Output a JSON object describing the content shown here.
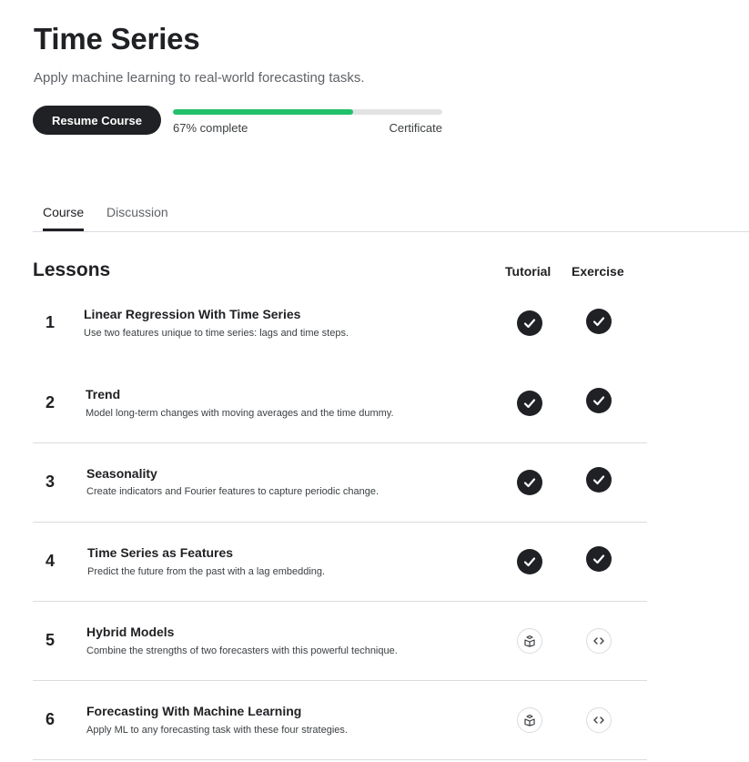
{
  "course": {
    "title": "Time Series",
    "subtitle": "Apply machine learning to real-world forecasting tasks.",
    "resume_label": "Resume Course",
    "progress_fraction": 0.67,
    "progress_text": "67% complete",
    "certificate_label": "Certificate",
    "accent_color": "#20c16a"
  },
  "tabs": [
    {
      "label": "Course",
      "active": true
    },
    {
      "label": "Discussion",
      "active": false
    }
  ],
  "lessons_section": {
    "heading": "Lessons",
    "tutorial_header": "Tutorial",
    "exercise_header": "Exercise"
  },
  "lessons": [
    {
      "num": "1",
      "title": "Linear Regression With Time Series",
      "desc": "Use two features unique to time series: lags and time steps.",
      "tutorial": "completed",
      "exercise": "completed"
    },
    {
      "num": "2",
      "title": "Trend",
      "desc": "Model long-term changes with moving averages and the time dummy.",
      "tutorial": "completed",
      "exercise": "completed"
    },
    {
      "num": "3",
      "title": "Seasonality",
      "desc": "Create indicators and Fourier features to capture periodic change.",
      "tutorial": "completed",
      "exercise": "completed"
    },
    {
      "num": "4",
      "title": "Time Series as Features",
      "desc": "Predict the future from the past with a lag embedding.",
      "tutorial": "completed",
      "exercise": "completed"
    },
    {
      "num": "5",
      "title": "Hybrid Models",
      "desc": "Combine the strengths of two forecasters with this powerful technique.",
      "tutorial": "not-started",
      "exercise": "not-started"
    },
    {
      "num": "6",
      "title": "Forecasting With Machine Learning",
      "desc": "Apply ML to any forecasting task with these four strategies.",
      "tutorial": "not-started",
      "exercise": "not-started"
    }
  ]
}
